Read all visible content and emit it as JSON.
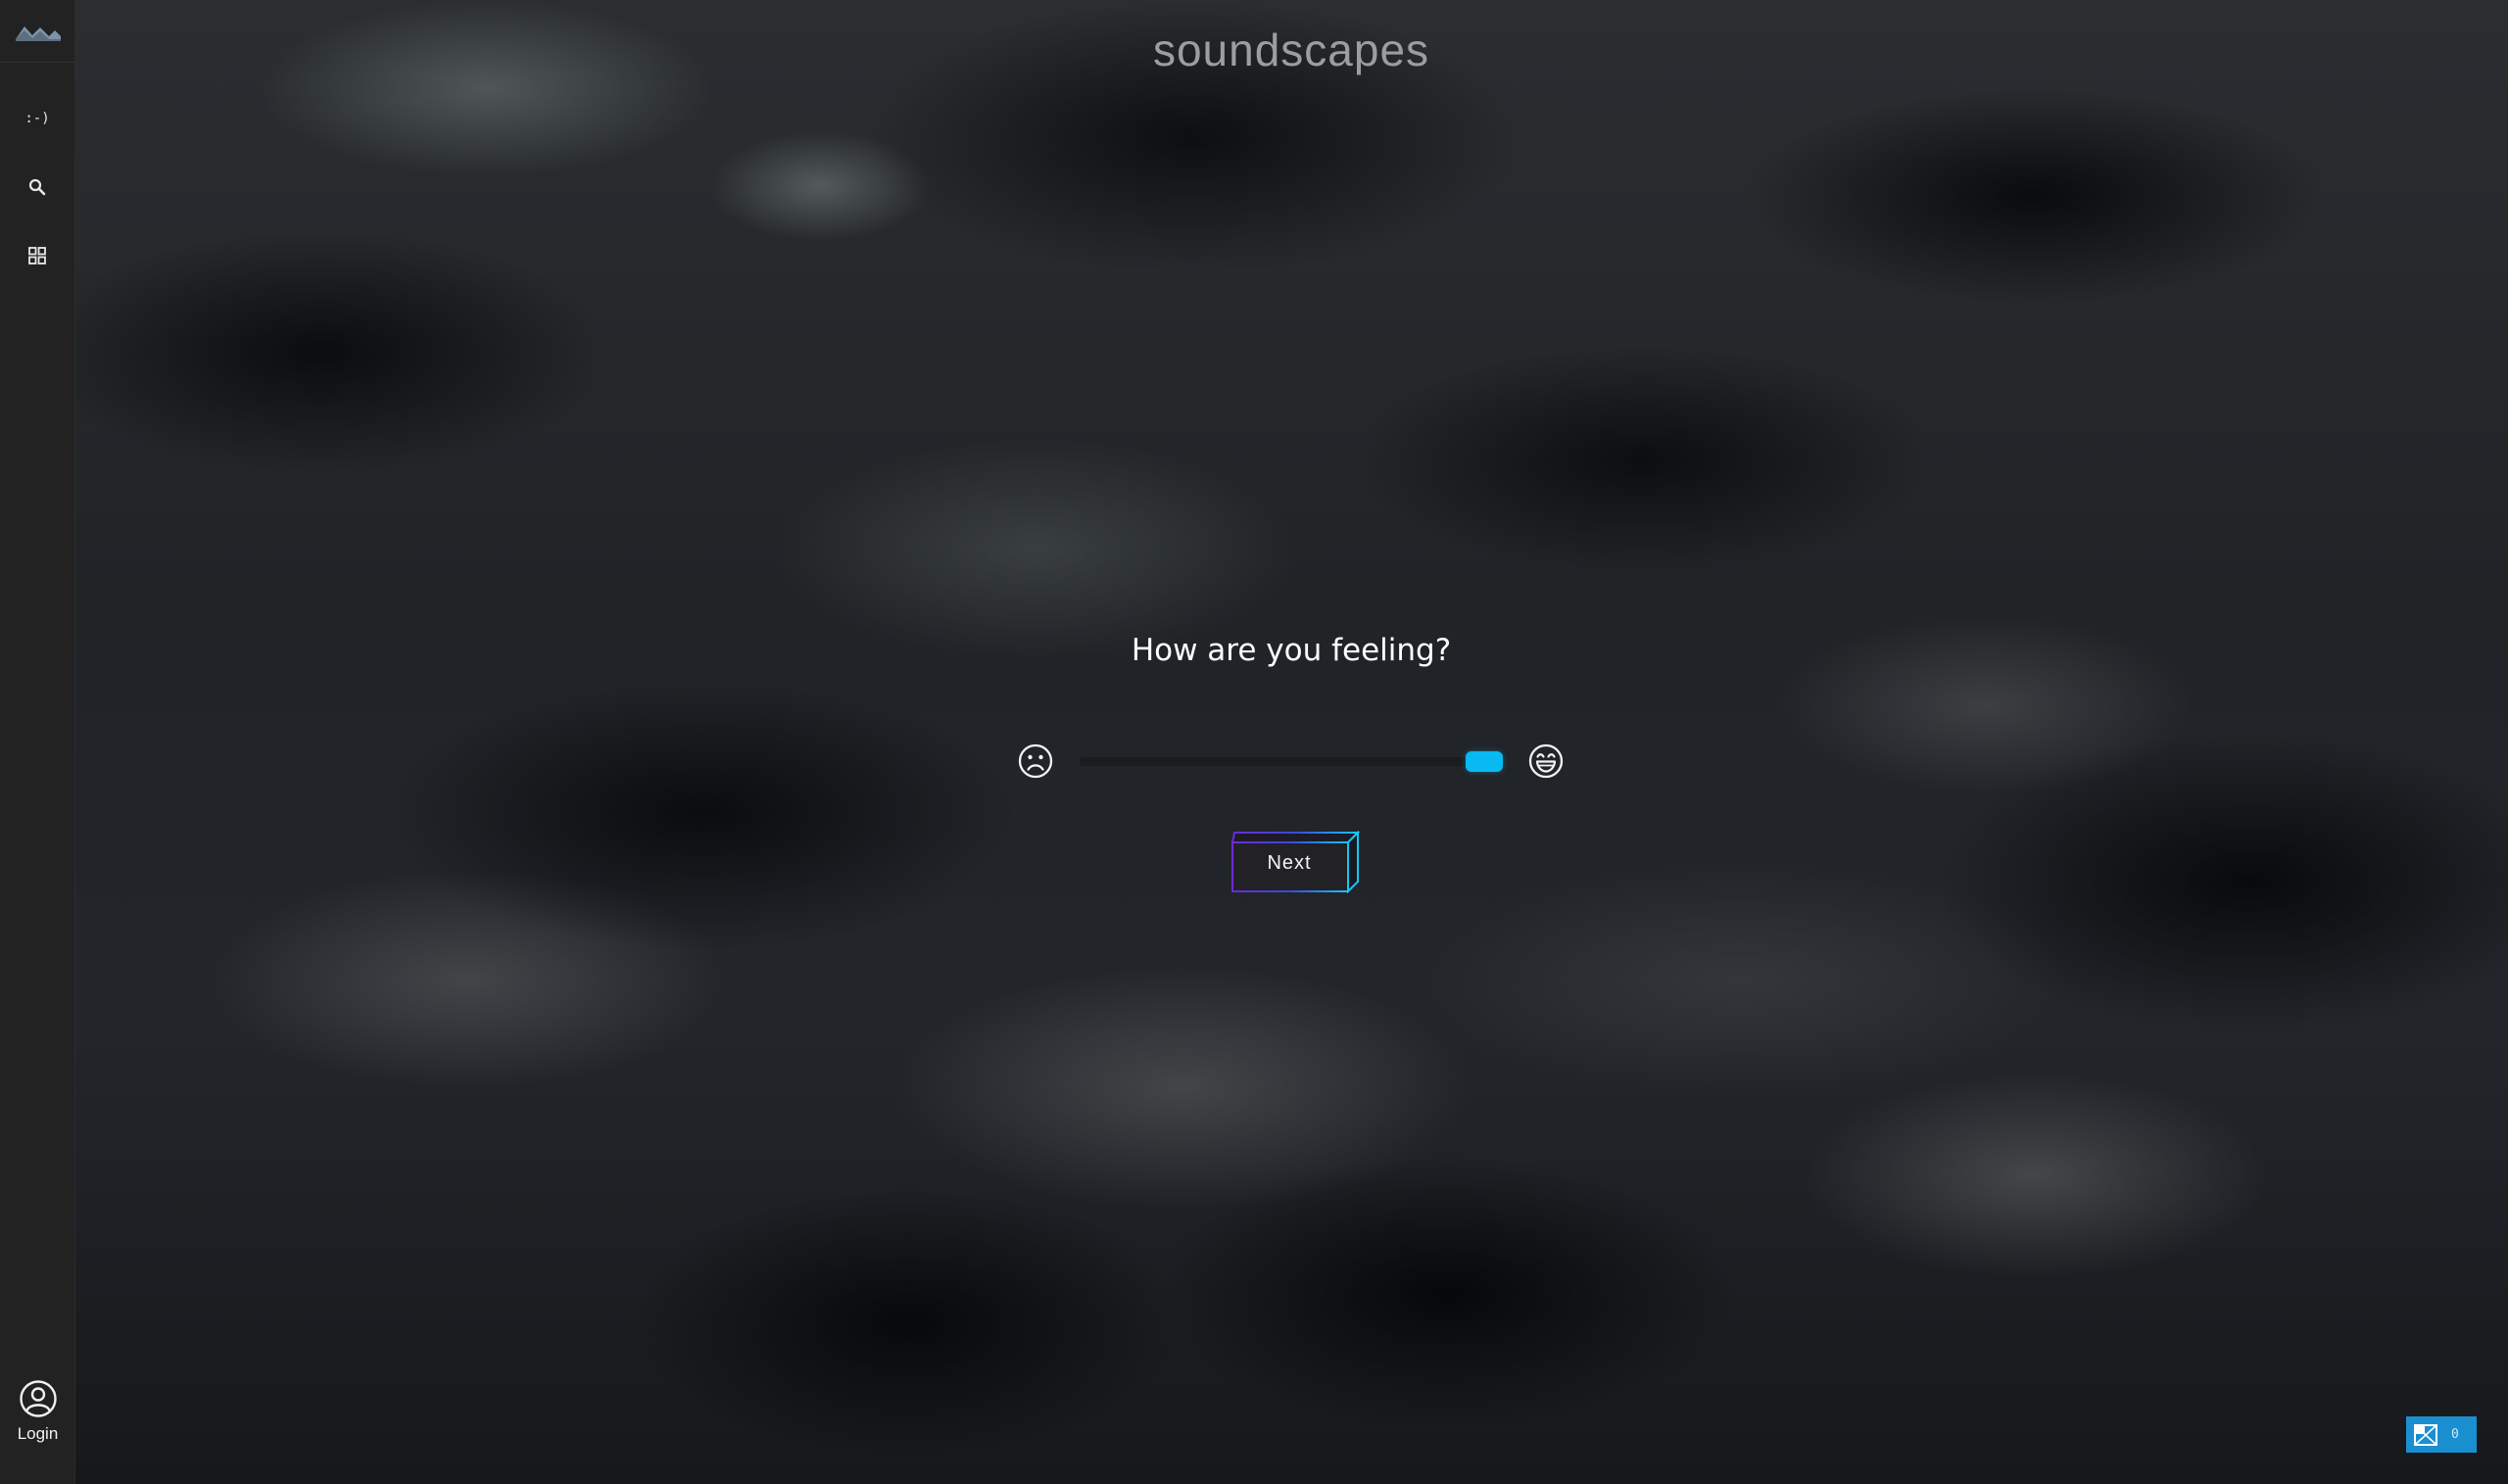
{
  "app": {
    "brand": "soundscapes"
  },
  "sidebar": {
    "items": [
      {
        "label": ":-)",
        "icon": "mood-emoticon-icon"
      },
      {
        "icon": "search-icon"
      },
      {
        "icon": "grid-icon"
      }
    ],
    "login_label": "Login"
  },
  "mood": {
    "question": "How are you feeling?",
    "slider_value": 1.0,
    "low_icon": "sad-face-icon",
    "high_icon": "happy-face-icon"
  },
  "actions": {
    "next_label": "Next"
  },
  "badge": {
    "count": "0"
  },
  "colors": {
    "accent": "#09b9f2",
    "sidebar_bg": "#222222",
    "badge_bg": "#1a8fd0",
    "brand_text": "#9b9ea1"
  }
}
